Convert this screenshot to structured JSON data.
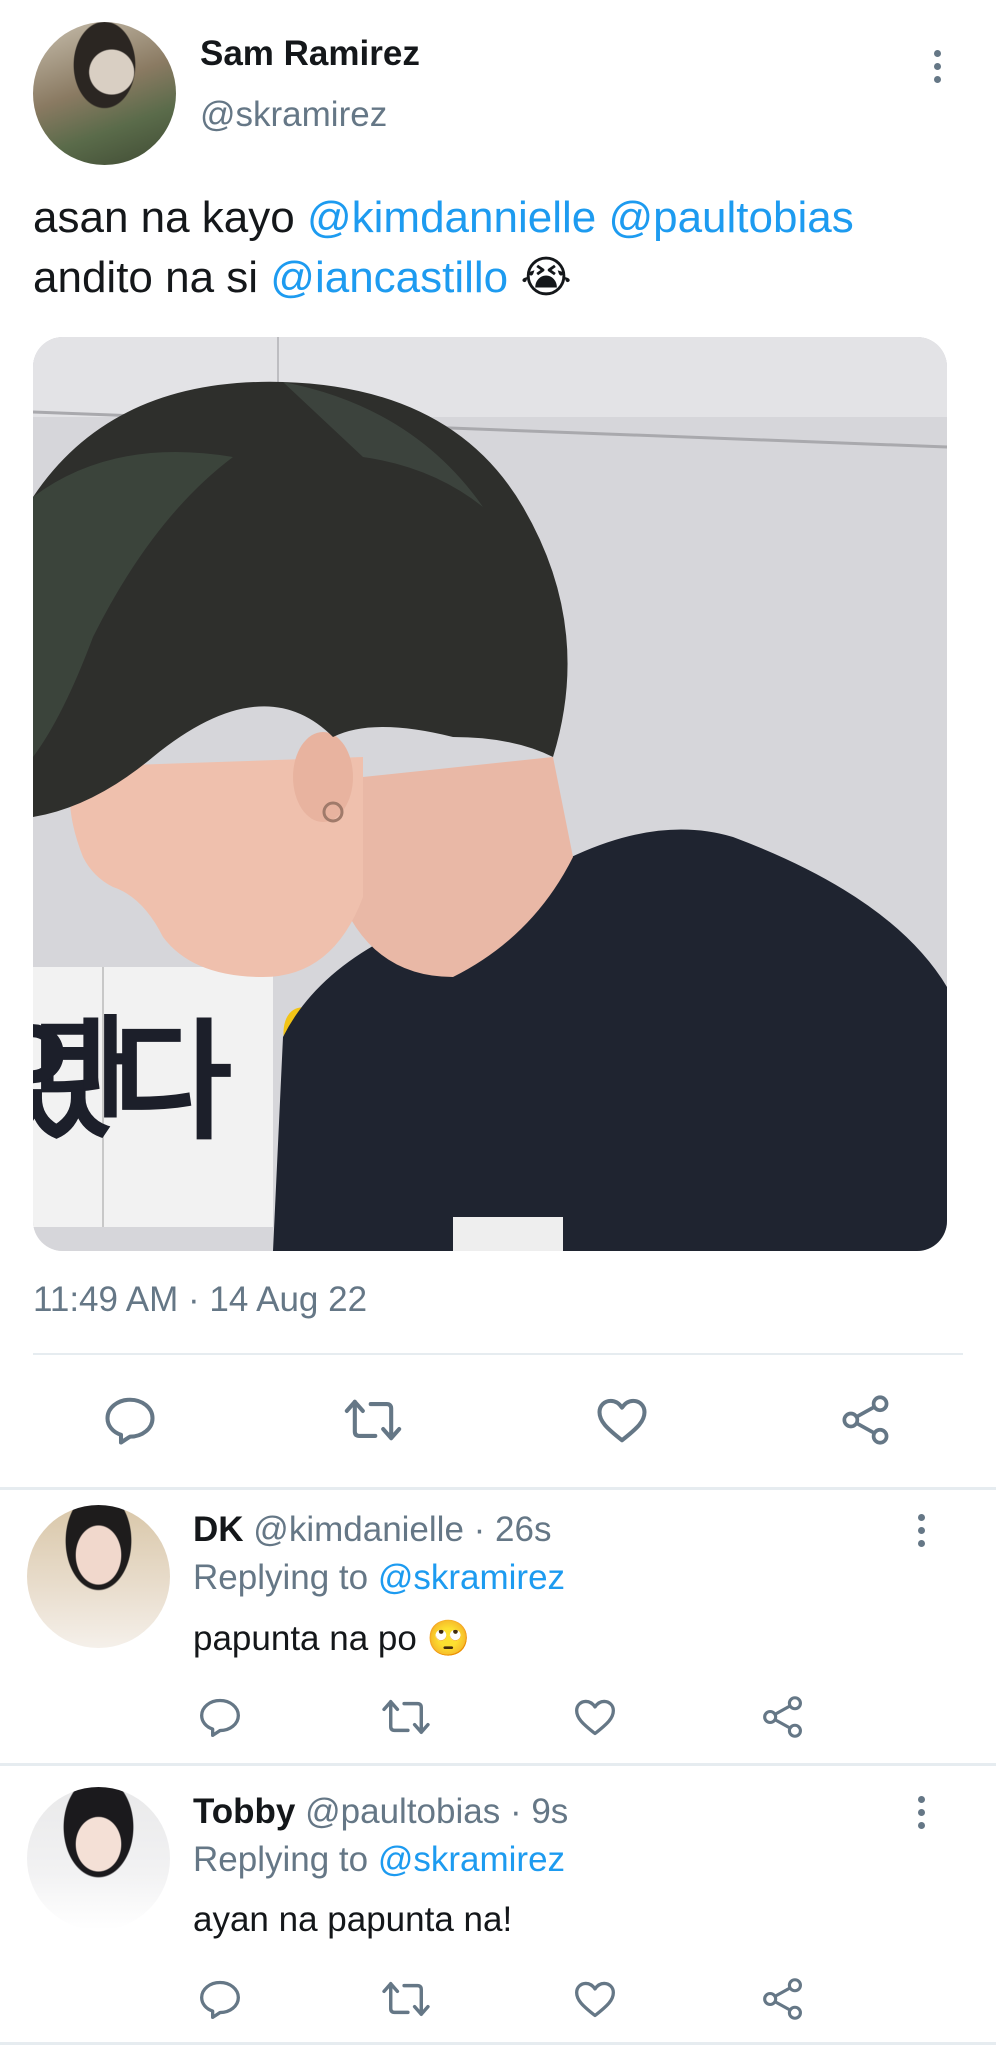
{
  "tweet": {
    "author_name": "Sam Ramirez",
    "author_handle": "@skramirez",
    "text_plain_1": "asan na kayo ",
    "mention_1": "@kimdannielle",
    "text_space": " ",
    "mention_2": "@paultobias",
    "text_plain_2": "andito na si ",
    "mention_3": "@iancastillo",
    "emoji": "😭",
    "timestamp": "11:49 AM · 14 Aug 22"
  },
  "actions": {
    "icons": [
      "reply-icon",
      "retweet-icon",
      "like-icon",
      "share-icon"
    ]
  },
  "replies": [
    {
      "name": "DK",
      "handle": "@kimdanielle",
      "sep_time": " · 26s",
      "replying_prefix": "Replying to ",
      "replying_handle": "@skramirez",
      "text": "papunta na po ",
      "emoji": "🙄"
    },
    {
      "name": "Tobby",
      "handle": "@paultobias",
      "sep_time": " · 9s",
      "replying_prefix": "Replying to ",
      "replying_handle": "@skramirez",
      "text": "ayan na papunta na!",
      "emoji": ""
    }
  ],
  "colors": {
    "link": "#1d9bf0",
    "secondary_text": "#657786",
    "divider": "#e6ecf0"
  },
  "media": {
    "korean_text_1": "다",
    "korean_text_2": "었다",
    "sticker": "🌽"
  }
}
